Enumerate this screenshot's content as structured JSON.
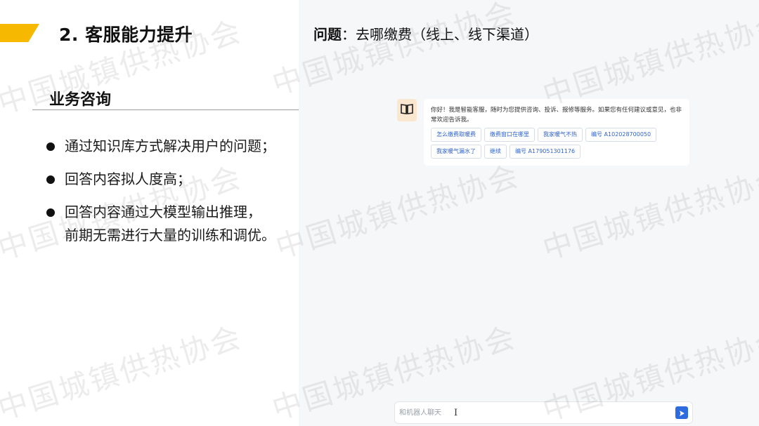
{
  "slide": {
    "title": "2. 客服能力提升",
    "section_heading": "业务咨询",
    "bullets": [
      "通过知识库方式解决用户的问题；",
      "回答内容拟人度高；",
      "回答内容通过大模型输出推理，\n前期无需进行大量的训练和调优。"
    ]
  },
  "question": {
    "label": "问题",
    "text": "：去哪缴费（线上、线下渠道）"
  },
  "chat": {
    "greeting": "你好！我是智能客服，随时为您提供咨询、投诉、报修等服务。如果您有任何建议或意见，也非常欢迎告诉我。",
    "suggestions": [
      "怎么缴费取暖费",
      "缴费窗口在哪里",
      "我家暖气不热",
      "编号 A102028700050",
      "我家暖气漏水了",
      "继续",
      "编号 A179051301176"
    ],
    "input_placeholder": "和机器人聊天"
  },
  "watermark_text": "中国城镇供热协会",
  "colors": {
    "accent": "#f6b800",
    "chip_text": "#2f63c8",
    "send_button": "#2d6cdf",
    "chat_panel_bg": "#f6f7f9"
  },
  "icons": {
    "avatar": "book-icon",
    "send": "send-arrow-icon"
  }
}
